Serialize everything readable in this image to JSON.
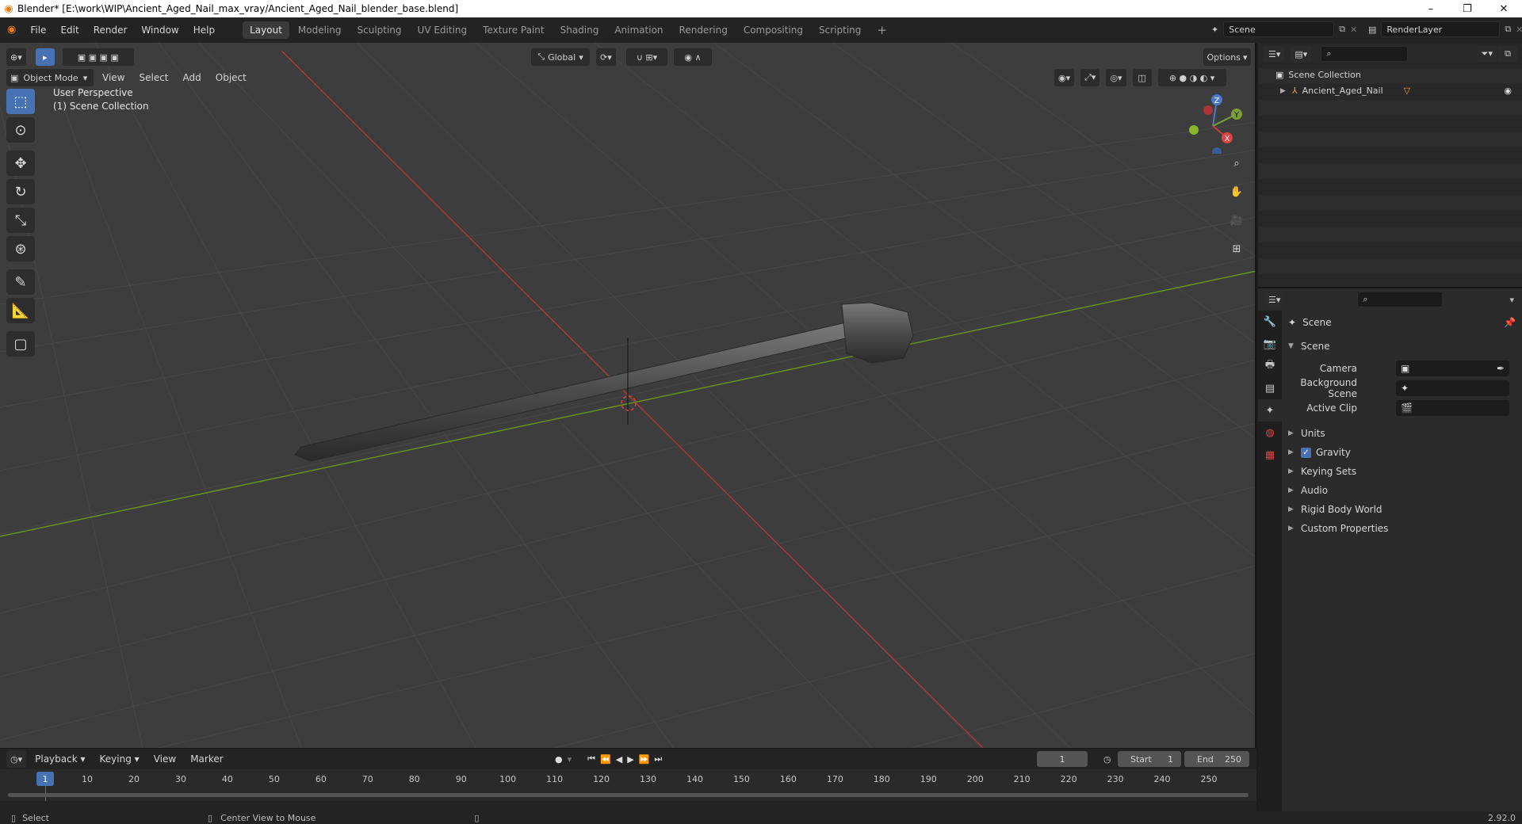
{
  "window": {
    "title": "Blender* [E:\\work\\WIP\\Ancient_Aged_Nail_max_vray/Ancient_Aged_Nail_blender_base.blend]",
    "minimize": "–",
    "maximize": "❐",
    "close": "✕"
  },
  "menu": {
    "items": [
      "File",
      "Edit",
      "Render",
      "Window",
      "Help"
    ]
  },
  "workspaces": {
    "tabs": [
      "Layout",
      "Modeling",
      "Sculpting",
      "UV Editing",
      "Texture Paint",
      "Shading",
      "Animation",
      "Rendering",
      "Compositing",
      "Scripting"
    ],
    "active": "Layout",
    "add": "+"
  },
  "scene_selector": {
    "value": "Scene"
  },
  "renderlayer_selector": {
    "value": "RenderLayer"
  },
  "viewport": {
    "mode": "Object Mode",
    "menus": [
      "View",
      "Select",
      "Add",
      "Object"
    ],
    "transform_orientation": "Global",
    "options_label": "Options",
    "overlay_line1": "User Perspective",
    "overlay_line2": "(1) Scene Collection",
    "gizmo": {
      "x": "X",
      "y": "Y",
      "z": "Z"
    }
  },
  "outliner": {
    "root": "Scene Collection",
    "items": [
      {
        "label": "Ancient_Aged_Nail"
      }
    ]
  },
  "properties": {
    "header_title": "Scene",
    "section_title": "Scene",
    "fields": [
      {
        "label": "Camera"
      },
      {
        "label": "Background Scene"
      },
      {
        "label": "Active Clip"
      }
    ],
    "panels": [
      "Units",
      "Gravity",
      "Keying Sets",
      "Audio",
      "Rigid Body World",
      "Custom Properties"
    ],
    "gravity_checked": true
  },
  "timeline": {
    "menus": [
      "Playback",
      "Keying",
      "View",
      "Marker"
    ],
    "current_frame": "1",
    "start_label": "Start",
    "start_value": "1",
    "end_label": "End",
    "end_value": "250",
    "ticks": [
      "10",
      "20",
      "30",
      "40",
      "50",
      "60",
      "70",
      "80",
      "90",
      "100",
      "110",
      "120",
      "130",
      "140",
      "150",
      "160",
      "170",
      "180",
      "190",
      "200",
      "210",
      "220",
      "230",
      "240",
      "250"
    ],
    "cursor": "1"
  },
  "statusbar": {
    "left": "Select",
    "middle": "Center View to Mouse",
    "version": "2.92.0"
  },
  "colors": {
    "accent": "#4772b3",
    "x_axis": "#c83c3c",
    "y_axis": "#7da12e",
    "viewport_bg": "#3d3d3d"
  }
}
